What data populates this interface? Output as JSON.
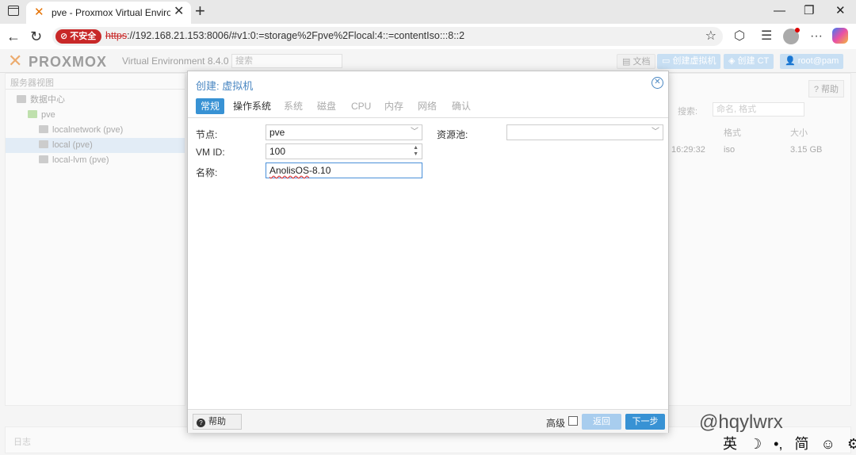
{
  "browser": {
    "tab_title": "pve - Proxmox Virtual Environment",
    "url_badge": "不安全",
    "url_proto": "https",
    "url_rest": "://192.168.21.153:8006/#v1:0:=storage%2Fpve%2Flocal:4::=contentIso:::8::2"
  },
  "pve": {
    "brand": "PROXMOX",
    "brand_sub": "Virtual Environment 8.4.0",
    "search_placeholder": "搜索",
    "header_buttons": {
      "docs": "文档",
      "create_vm": "创建虚拟机",
      "create_ct": "创建 CT",
      "user": "root@pam"
    },
    "tree": {
      "view": "服务器视图",
      "items": [
        "数据中心",
        "pve",
        "localnetwork (pve)",
        "local (pve)",
        "local-lvm (pve)"
      ]
    },
    "right": {
      "help": "帮助",
      "search_label": "搜索:",
      "search_placeholder": "命名, 格式",
      "col_format": "格式",
      "col_size": "大小",
      "row_time": "16:29:32",
      "row_format": "iso",
      "row_size": "3.15 GB"
    },
    "log_label": "日志"
  },
  "dialog": {
    "title": "创建: 虚拟机",
    "tabs": [
      "常规",
      "操作系统",
      "系统",
      "磁盘",
      "CPU",
      "内存",
      "网络",
      "确认"
    ],
    "fields": {
      "node_label": "节点:",
      "node_value": "pve",
      "pool_label": "资源池:",
      "vmid_label": "VM ID:",
      "vmid_value": "100",
      "name_label": "名称:",
      "name_value_a": "AnolisOS",
      "name_value_b": "-8.10"
    },
    "footer": {
      "help": "帮助",
      "advanced": "高级",
      "back": "返回",
      "next": "下一步"
    }
  },
  "overlay": {
    "watermark": "@hqylwrx",
    "ime": [
      "英",
      "☽",
      "•,",
      "简",
      "☺",
      "⚙"
    ]
  }
}
